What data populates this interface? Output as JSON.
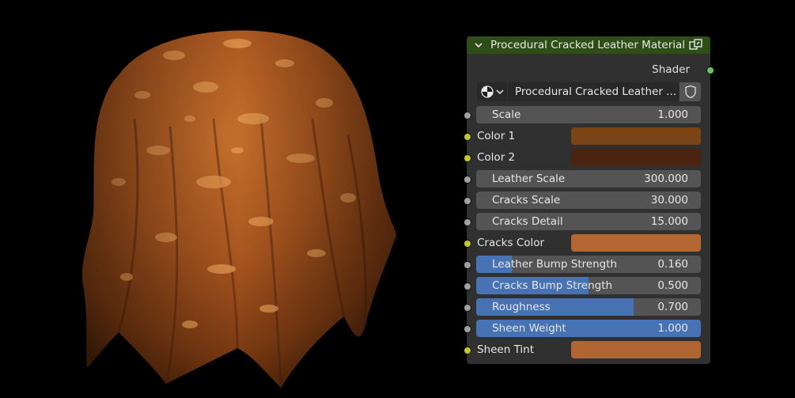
{
  "node": {
    "title": "Procedural Cracked Leather Material",
    "output": "Shader",
    "material_name": "Procedural Cracked Leather ...",
    "scale": {
      "label": "Scale",
      "value": "1.000"
    },
    "color1": {
      "label": "Color 1",
      "color": "#7a4417"
    },
    "color2": {
      "label": "Color 2",
      "color": "#4a2410"
    },
    "leather_scale": {
      "label": "Leather Scale",
      "value": "300.000"
    },
    "cracks_scale": {
      "label": "Cracks Scale",
      "value": "30.000"
    },
    "cracks_detail": {
      "label": "Cracks Detail",
      "value": "15.000"
    },
    "cracks_color": {
      "label": "Cracks Color",
      "color": "#b56733"
    },
    "leather_bump": {
      "label": "Leather Bump Strength",
      "value": "0.160",
      "fraction": 0.16
    },
    "cracks_bump": {
      "label": "Cracks Bump Strength",
      "value": "0.500",
      "fraction": 0.5
    },
    "roughness": {
      "label": "Roughness",
      "value": "0.700",
      "fraction": 0.7
    },
    "sheen_weight": {
      "label": "Sheen Weight",
      "value": "1.000",
      "fraction": 1.0
    },
    "sheen_tint": {
      "label": "Sheen Tint",
      "color": "#b06532"
    }
  },
  "colors": {
    "header": "#2e4d17",
    "panel": "#303030",
    "field": "#545454",
    "slider_fill": "#4772b3",
    "socket_float": "#a1a1a1",
    "socket_color": "#c7c729",
    "socket_shader": "#63c763"
  },
  "icons": [
    "chevron-down-icon",
    "node-group-icon",
    "material-sphere-icon",
    "shield-icon"
  ]
}
